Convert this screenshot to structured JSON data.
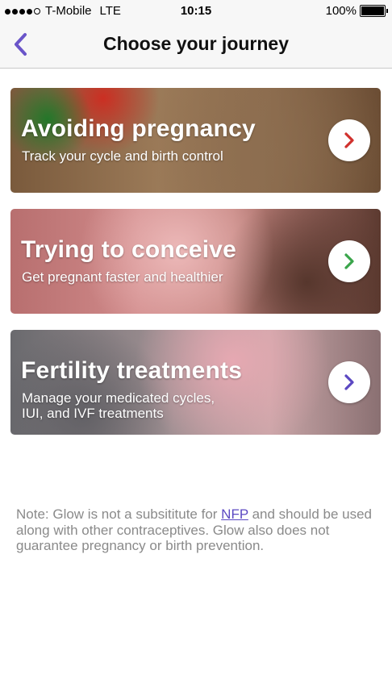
{
  "status_bar": {
    "carrier": "T-Mobile",
    "network": "LTE",
    "time": "10:15",
    "battery": "100%"
  },
  "nav": {
    "title": "Choose your journey",
    "back_icon": "chevron-left-icon",
    "accent_color": "#6a55c9"
  },
  "cards": [
    {
      "title": "Avoiding pregnancy",
      "subtitle": "Track your cycle and birth control",
      "arrow_color": "#d0312d"
    },
    {
      "title": "Trying to conceive",
      "subtitle": "Get pregnant faster and healthier",
      "arrow_color": "#3aa54b"
    },
    {
      "title": "Fertility treatments",
      "subtitle_line1": "Manage your medicated cycles,",
      "subtitle_line2": "IUI, and IVF treatments",
      "arrow_color": "#5b48c2"
    }
  ],
  "note": {
    "prefix": "Note: Glow is not a subsititute for ",
    "link": "NFP",
    "suffix": " and should be used along with other contraceptives. Glow also does not guarantee pregnancy or birth prevention."
  }
}
